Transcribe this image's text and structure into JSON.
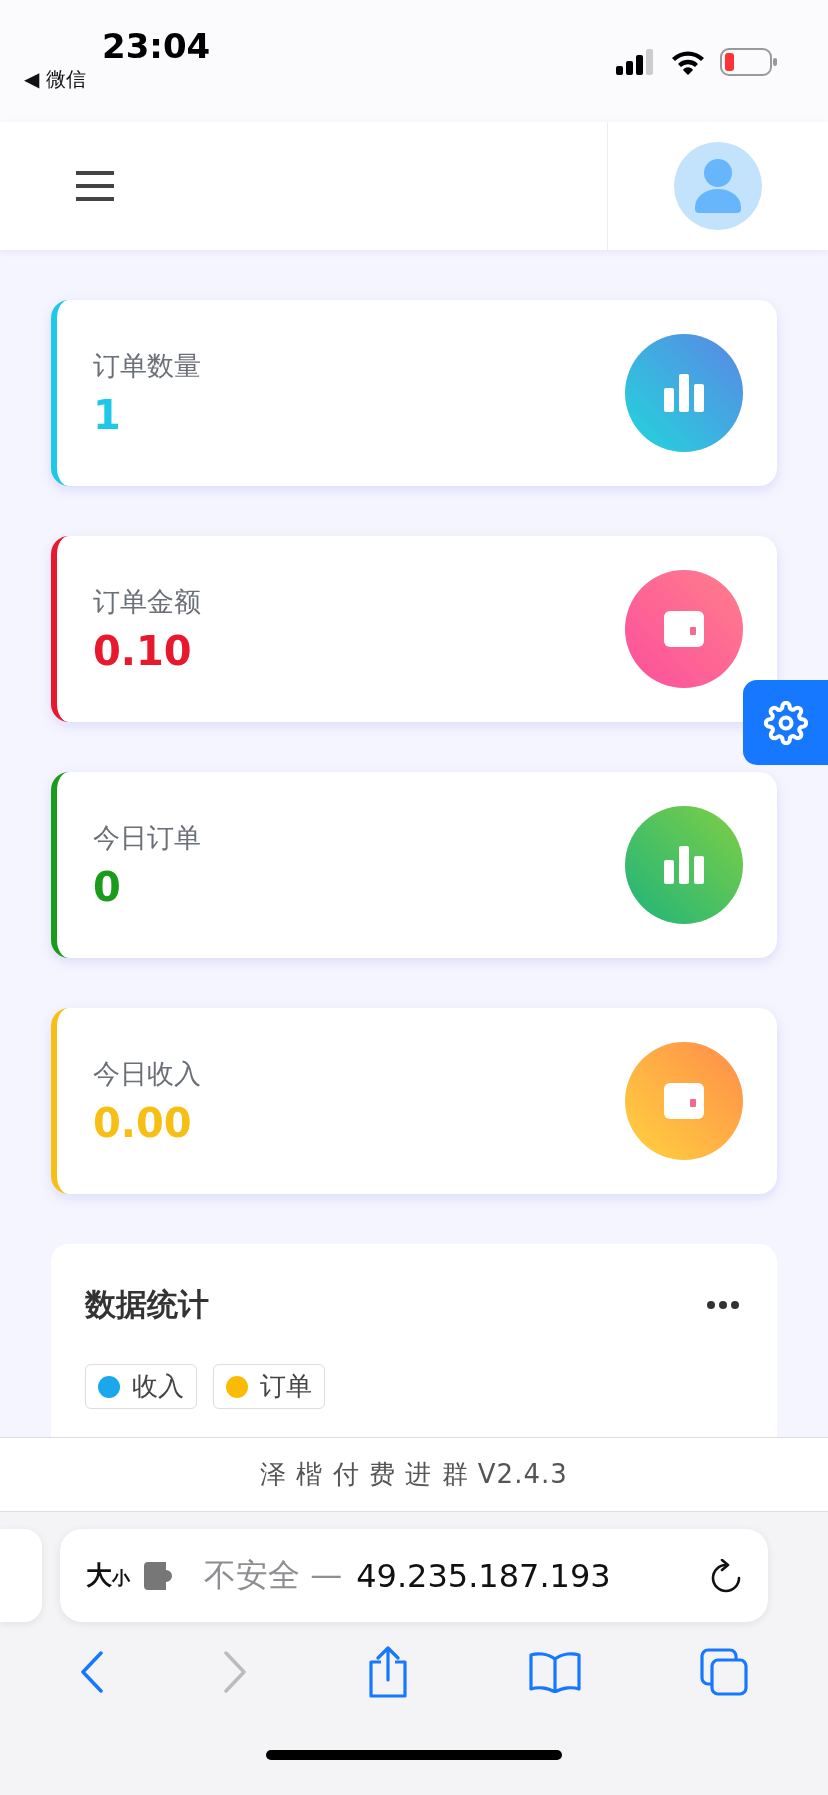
{
  "status_bar": {
    "time": "23:04",
    "back_label": "◀ 微信"
  },
  "stats": [
    {
      "label": "订单数量",
      "value": "1",
      "color": "#1ec8e8",
      "kind": "chart"
    },
    {
      "label": "订单金额",
      "value": "0.10",
      "color": "#e8192c",
      "kind": "wallet"
    },
    {
      "label": "今日订单",
      "value": "0",
      "color": "#1a9c1a",
      "kind": "chart"
    },
    {
      "label": "今日收入",
      "value": "0.00",
      "color": "#f7bf16",
      "kind": "wallet"
    }
  ],
  "data_panel": {
    "title": "数据统计",
    "legend": [
      {
        "label": "收入",
        "color": "#1aa7ec"
      },
      {
        "label": "订单",
        "color": "#fbbb05"
      }
    ]
  },
  "footer": "泽 楷 付 费 进 群 V2.4.3",
  "browser": {
    "reader_label": "大$_{小}$",
    "security": "不安全 —",
    "host": "49.235.187.193"
  }
}
